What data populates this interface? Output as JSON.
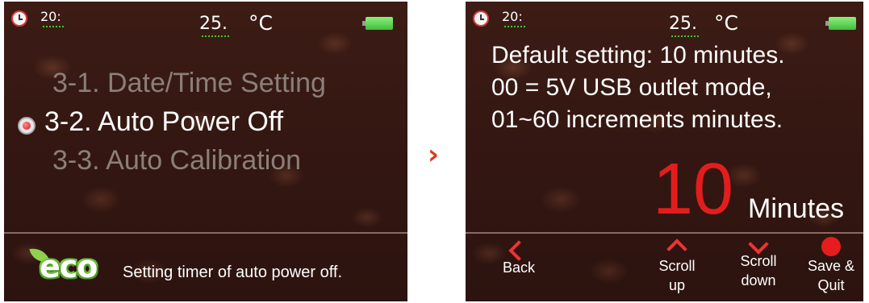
{
  "left_screen": {
    "status_bar": {
      "time": "20:",
      "temperature": "25.",
      "temperature_unit": "°C",
      "icons": [
        "clock-icon",
        "battery-icon"
      ],
      "battery_color": "#3fbd3f"
    },
    "menu": {
      "items": [
        {
          "label": "3-1. Date/Time Setting",
          "state": "dim"
        },
        {
          "label": "3-2. Auto Power Off",
          "state": "selected"
        },
        {
          "label": "3-3. Auto Calibration",
          "state": "dim"
        }
      ]
    },
    "footer": {
      "badge": "eco",
      "description": "Setting timer of auto power off."
    }
  },
  "separator_icon": "chevron-right-icon",
  "right_screen": {
    "status_bar": {
      "time": "20:",
      "temperature": "25.",
      "temperature_unit": "°C",
      "icons": [
        "clock-icon",
        "battery-icon"
      ]
    },
    "info_lines": [
      "Default setting: 10 minutes.",
      "00 = 5V USB outlet mode,",
      "01~60 increments minutes."
    ],
    "value": "10",
    "value_color": "#e21d1d",
    "unit": "Minutes",
    "controls": [
      {
        "label_lines": [
          "Back"
        ],
        "icon": "chevron-left-icon"
      },
      {
        "label_lines": [
          "Scroll",
          "up"
        ],
        "icon": "chevron-up-icon"
      },
      {
        "label_lines": [
          "Scroll",
          "down"
        ],
        "icon": "chevron-down-icon"
      },
      {
        "label_lines": [
          "Save &",
          "Quit"
        ],
        "icon": "dot-icon"
      }
    ]
  },
  "colors": {
    "background": "#331611",
    "accent_red": "#e51d1d",
    "eco_green": "#5aa62e"
  }
}
